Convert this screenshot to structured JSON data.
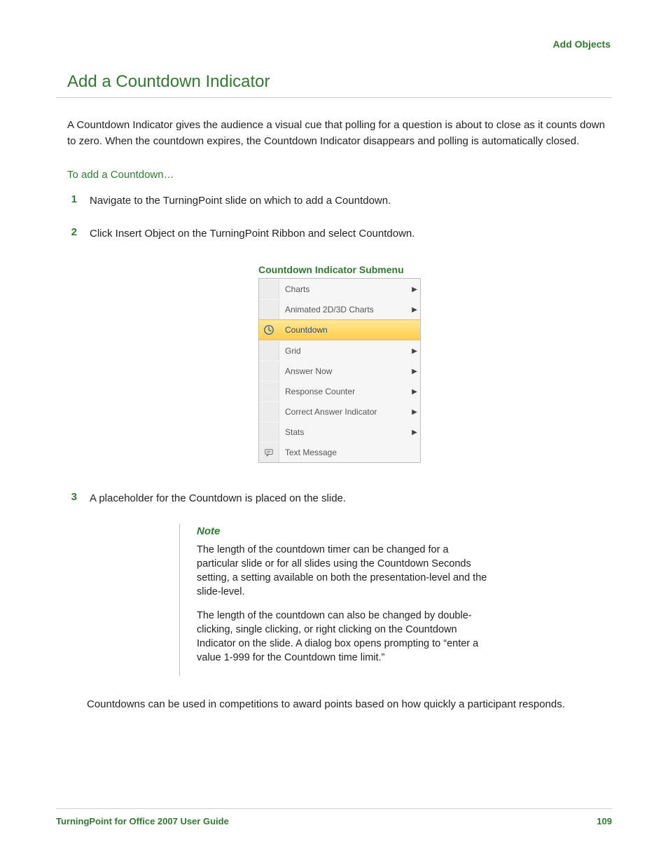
{
  "header": {
    "section": "Add Objects"
  },
  "title": "Add a Countdown Indicator",
  "intro": "A Countdown Indicator gives the audience a visual cue that polling for a question is about to close as it counts down to zero. When the countdown expires, the Countdown Indicator disappears and polling is automatically closed.",
  "subhead": "To add a Countdown…",
  "steps": [
    {
      "n": "1",
      "text": "Navigate to the TurningPoint slide on which to add a Countdown."
    },
    {
      "n": "2",
      "text": "Click Insert Object on the TurningPoint Ribbon and select Countdown."
    },
    {
      "n": "3",
      "text": "A placeholder for the Countdown is placed on the slide."
    }
  ],
  "figure": {
    "caption": "Countdown Indicator Submenu",
    "items": [
      {
        "label": "Charts",
        "arrow": true,
        "icon": "",
        "selected": false
      },
      {
        "label": "Animated 2D/3D Charts",
        "arrow": true,
        "icon": "",
        "selected": false
      },
      {
        "label": "Countdown",
        "arrow": false,
        "icon": "clock",
        "selected": true
      },
      {
        "label": "Grid",
        "arrow": true,
        "icon": "",
        "selected": false
      },
      {
        "label": "Answer Now",
        "arrow": true,
        "icon": "",
        "selected": false
      },
      {
        "label": "Response Counter",
        "arrow": true,
        "icon": "",
        "selected": false
      },
      {
        "label": "Correct Answer Indicator",
        "arrow": true,
        "icon": "",
        "selected": false
      },
      {
        "label": "Stats",
        "arrow": true,
        "icon": "",
        "selected": false
      },
      {
        "label": "Text Message",
        "arrow": false,
        "icon": "message",
        "selected": false
      }
    ]
  },
  "note": {
    "head": "Note",
    "p1": "The length of the countdown timer can be changed for a particular slide or for all slides using the Countdown Seconds setting, a setting available on both the presentation-level and the slide-level.",
    "p2": "The length of the countdown can also be changed by double-clicking, single clicking, or right clicking on the Countdown Indicator on the slide. A dialog box opens prompting to “enter a value 1-999 for the Countdown time limit.”"
  },
  "closing": "Countdowns can be used in competitions to award points based on how quickly a participant responds.",
  "footer": {
    "left": "TurningPoint for Office 2007 User Guide",
    "right": "109"
  }
}
